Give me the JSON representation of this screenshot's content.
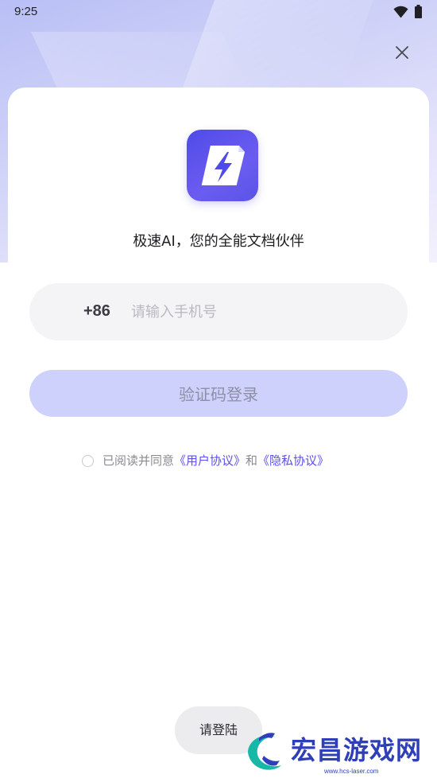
{
  "status_bar": {
    "time": "9:25",
    "icons": [
      "wifi-icon",
      "battery-icon"
    ]
  },
  "header": {
    "close_icon": "close-icon"
  },
  "app": {
    "logo_icon": "lightning-document-icon",
    "tagline": "极速AI，您的全能文档伙伴"
  },
  "login_form": {
    "country_code": "+86",
    "phone_placeholder": "请输入手机号",
    "phone_value": "",
    "submit_label": "验证码登录"
  },
  "agreement": {
    "prefix": "已阅读并同意",
    "user_agreement": "《用户协议》",
    "conjunction": "和",
    "privacy_policy": "《隐私协议》",
    "checked": false
  },
  "toast": {
    "text": "请登陆"
  },
  "watermark": {
    "text": "宏昌游戏网",
    "url": "www.hcs-laser.com"
  },
  "colors": {
    "accent": "#5b4ff0",
    "button_disabled": "#cdd1fb",
    "logo": "#5a54e6",
    "watermark": "#2f3fb8"
  }
}
